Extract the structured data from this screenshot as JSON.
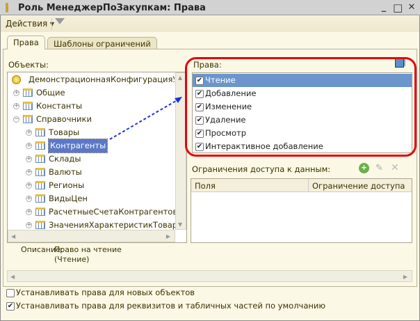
{
  "window": {
    "title": "Роль МенеджерПоЗакупкам: Права",
    "minimize": "_",
    "maximize": "□",
    "close": "✕"
  },
  "toolbar": {
    "actions_label": "Действия ▾",
    "filter_icon": "filter-icon"
  },
  "tabs": [
    {
      "label": "Права",
      "active": true
    },
    {
      "label": "Шаблоны ограничений",
      "active": false
    }
  ],
  "objects": {
    "label": "Объекты:",
    "root": "ДемонстрационнаяКонфигурацияУправл",
    "items": [
      {
        "label": "Общие",
        "level": 1,
        "expander": "+"
      },
      {
        "label": "Константы",
        "level": 1,
        "expander": "+"
      },
      {
        "label": "Справочники",
        "level": 1,
        "expander": "−"
      },
      {
        "label": "Товары",
        "level": 2,
        "expander": "+"
      },
      {
        "label": "Контрагенты",
        "level": 2,
        "expander": "+",
        "selected": true
      },
      {
        "label": "Склады",
        "level": 2,
        "expander": "+"
      },
      {
        "label": "Валюты",
        "level": 2,
        "expander": "+"
      },
      {
        "label": "Регионы",
        "level": 2,
        "expander": "+"
      },
      {
        "label": "ВидыЦен",
        "level": 2,
        "expander": "+"
      },
      {
        "label": "РасчетныеСчетаКонтрагентов",
        "level": 2,
        "expander": "+"
      },
      {
        "label": "ЗначенияХарактеристикТоваров",
        "level": 2,
        "expander": "+"
      }
    ]
  },
  "rights": {
    "label": "Права:",
    "items": [
      {
        "label": "Чтение",
        "checked": true,
        "selected": true
      },
      {
        "label": "Добавление",
        "checked": true
      },
      {
        "label": "Изменение",
        "checked": true
      },
      {
        "label": "Удаление",
        "checked": true
      },
      {
        "label": "Просмотр",
        "checked": true
      },
      {
        "label": "Интерактивное добавление",
        "checked": true
      }
    ]
  },
  "restrictions": {
    "label": "Ограничения доступа к данным:",
    "columns": [
      "Поля",
      "Ограничение доступа"
    ]
  },
  "description": {
    "label": "Описание:",
    "line1": "Право на чтение",
    "line2": "(Чтение)"
  },
  "options": [
    {
      "label": "Устанавливать права для новых объектов",
      "checked": false
    },
    {
      "label": "Устанавливать права для реквизитов и табличных частей по умолчанию",
      "checked": true
    }
  ],
  "colors": {
    "highlight": "#e8000a",
    "selection": "#6b95cc",
    "arrow": "#1a33e0"
  }
}
